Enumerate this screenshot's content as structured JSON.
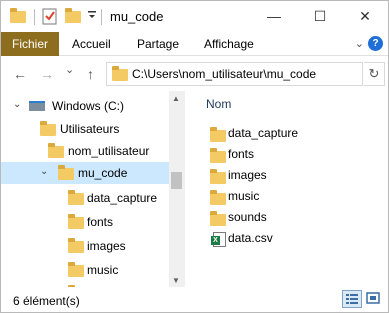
{
  "window": {
    "title": "mu_code",
    "controls": {
      "minimize": "—",
      "maximize": "☐",
      "close": "✕"
    }
  },
  "ribbon": {
    "file_tab": "Fichier",
    "tabs": [
      "Accueil",
      "Partage",
      "Affichage"
    ],
    "help": "?"
  },
  "nav": {
    "back": "←",
    "forward": "→",
    "recent": "⌄",
    "up": "↑",
    "address": "C:\\Users\\nom_utilisateur\\mu_code",
    "refresh": "↻"
  },
  "tree": {
    "items": [
      {
        "label": "Windows (C:)",
        "icon": "drive-icon",
        "expanded": true
      },
      {
        "label": "Utilisateurs",
        "icon": "folder-icon"
      },
      {
        "label": "nom_utilisateur",
        "icon": "folder-icon"
      },
      {
        "label": "mu_code",
        "icon": "folder-icon",
        "selected": true,
        "expanded": true
      },
      {
        "label": "data_capture",
        "icon": "folder-icon"
      },
      {
        "label": "fonts",
        "icon": "folder-icon"
      },
      {
        "label": "images",
        "icon": "folder-icon"
      },
      {
        "label": "music",
        "icon": "folder-icon"
      }
    ]
  },
  "content": {
    "column_header": "Nom",
    "items": [
      {
        "label": "data_capture",
        "icon": "folder-icon"
      },
      {
        "label": "fonts",
        "icon": "folder-icon"
      },
      {
        "label": "images",
        "icon": "folder-icon"
      },
      {
        "label": "music",
        "icon": "folder-icon"
      },
      {
        "label": "sounds",
        "icon": "folder-icon"
      },
      {
        "label": "data.csv",
        "icon": "excel-csv-icon"
      }
    ]
  },
  "status": {
    "item_count": "6 élément(s)",
    "view": "details"
  },
  "colors": {
    "file_tab": "#8d6e1f",
    "selection": "#cce8ff",
    "folder": "#f4ca64",
    "header_text": "#1e395b"
  }
}
